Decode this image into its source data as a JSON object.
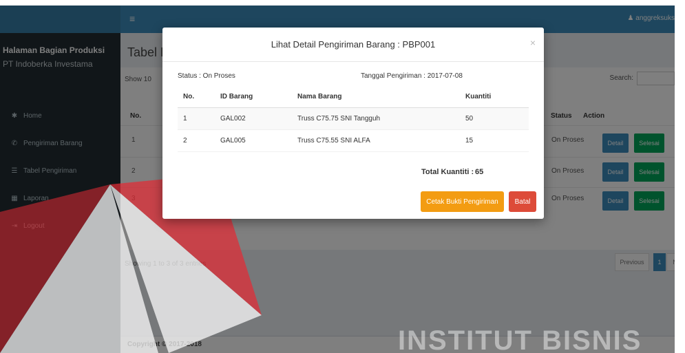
{
  "topbar": {
    "toggle": "≡",
    "user": "♟ anggreksuks"
  },
  "sidebar": {
    "brand": "Halaman Bagian Produksi",
    "company": "PT Indoberka Investama",
    "items": [
      {
        "icon": "✱",
        "icon_name": "home-icon",
        "label": "Home"
      },
      {
        "icon": "✆",
        "icon_name": "shipping-icon",
        "label": "Pengiriman Barang"
      },
      {
        "icon": "☰",
        "icon_name": "table-icon",
        "label": "Tabel Pengiriman"
      },
      {
        "icon": "▦",
        "icon_name": "report-icon",
        "label": "Laporan"
      },
      {
        "icon": "⇥",
        "icon_name": "logout-icon",
        "label": "Logout"
      }
    ]
  },
  "content": {
    "page_title": "Tabel P",
    "show_label": "Show",
    "show_value": "10",
    "search_label": "Search:",
    "columns": {
      "no": "No.",
      "status": "Status",
      "action": "Action"
    },
    "rows": [
      {
        "no": "1",
        "status": "On Proses"
      },
      {
        "no": "2",
        "status": "On Proses"
      },
      {
        "no": "3",
        "status": "On Proses"
      }
    ],
    "detail_label": "Detail",
    "selesai_label": "Selesai",
    "info": "Showing 1 to 3 of 3 entries",
    "pager_prev": "Previous",
    "pager_page": "1",
    "pager_next": "Ne",
    "footer": "Copyright © 2017-2018"
  },
  "modal": {
    "title": "Lihat Detail Pengiriman Barang : PBP001",
    "close": "×",
    "status": "Status : On Proses",
    "date": "Tanggal Pengiriman : 2017-07-08",
    "columns": {
      "no": "No.",
      "id": "ID Barang",
      "name": "Nama Barang",
      "qty": "Kuantiti"
    },
    "items": [
      {
        "no": "1",
        "id": "GAL002",
        "name": "Truss C75.75 SNI Tangguh",
        "qty": "50"
      },
      {
        "no": "2",
        "id": "GAL005",
        "name": "Truss C75.55 SNI ALFA",
        "qty": "15"
      }
    ],
    "total_label": "Total Kuantiti :",
    "total_value": "65",
    "print_label": "Cetak Bukti Pengiriman",
    "cancel_label": "Batal"
  },
  "watermark": {
    "text": "INSTITUT BISNIS",
    "color": "#e32b35"
  }
}
